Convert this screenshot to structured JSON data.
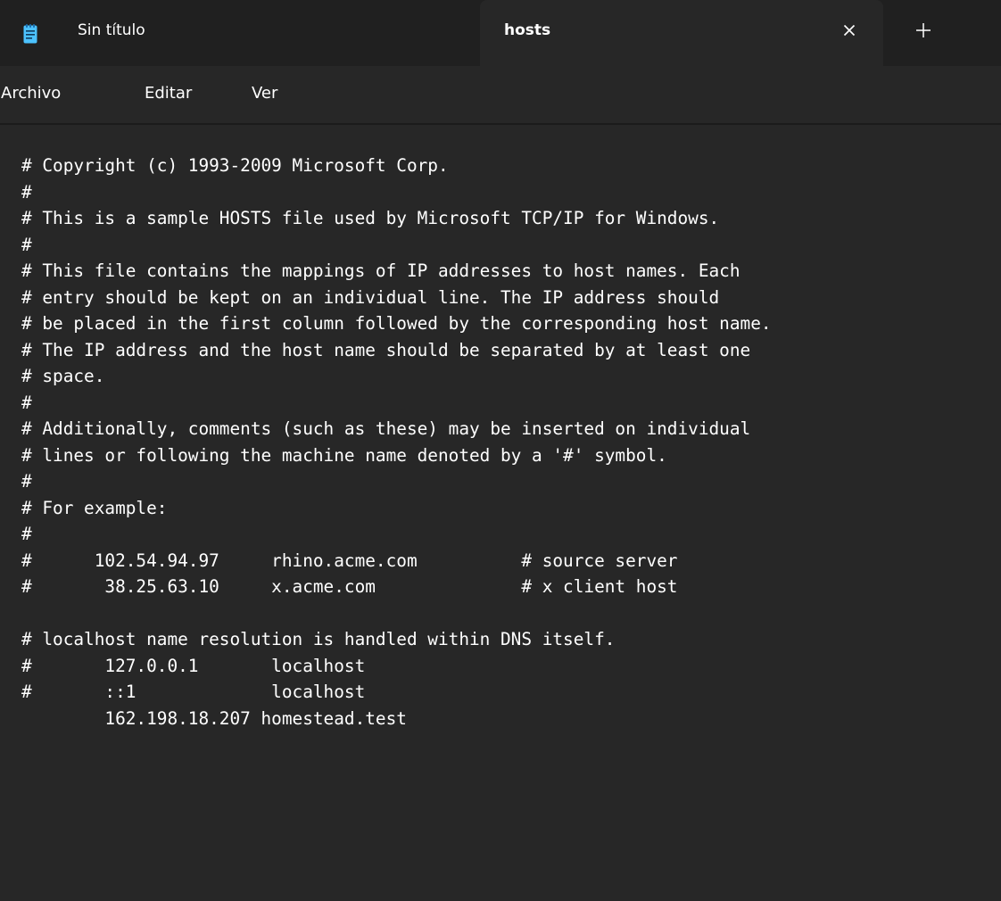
{
  "tabs": [
    {
      "label": "Sin título",
      "active": false
    },
    {
      "label": "hosts",
      "active": true
    }
  ],
  "menu": {
    "file": "Archivo",
    "edit": "Editar",
    "view": "Ver"
  },
  "editor": {
    "lines": [
      "# Copyright (c) 1993-2009 Microsoft Corp.",
      "#",
      "# This is a sample HOSTS file used by Microsoft TCP/IP for Windows.",
      "#",
      "# This file contains the mappings of IP addresses to host names. Each",
      "# entry should be kept on an individual line. The IP address should",
      "# be placed in the first column followed by the corresponding host name.",
      "# The IP address and the host name should be separated by at least one",
      "# space.",
      "#",
      "# Additionally, comments (such as these) may be inserted on individual",
      "# lines or following the machine name denoted by a '#' symbol.",
      "#",
      "# For example:",
      "#",
      "#      102.54.94.97     rhino.acme.com          # source server",
      "#       38.25.63.10     x.acme.com              # x client host",
      "",
      "# localhost name resolution is handled within DNS itself.",
      "#       127.0.0.1       localhost",
      "#       ::1             localhost",
      "        162.198.18.207 homestead.test"
    ]
  },
  "colors": {
    "titlebar_bg": "#202020",
    "editor_bg": "#272727",
    "text": "#ffffff",
    "spellcheck_underline": "#e81123",
    "notepad_icon": "#4cc2ff"
  },
  "icons": {
    "app": "notepad-icon",
    "close": "close-icon",
    "new_tab": "plus-icon"
  }
}
